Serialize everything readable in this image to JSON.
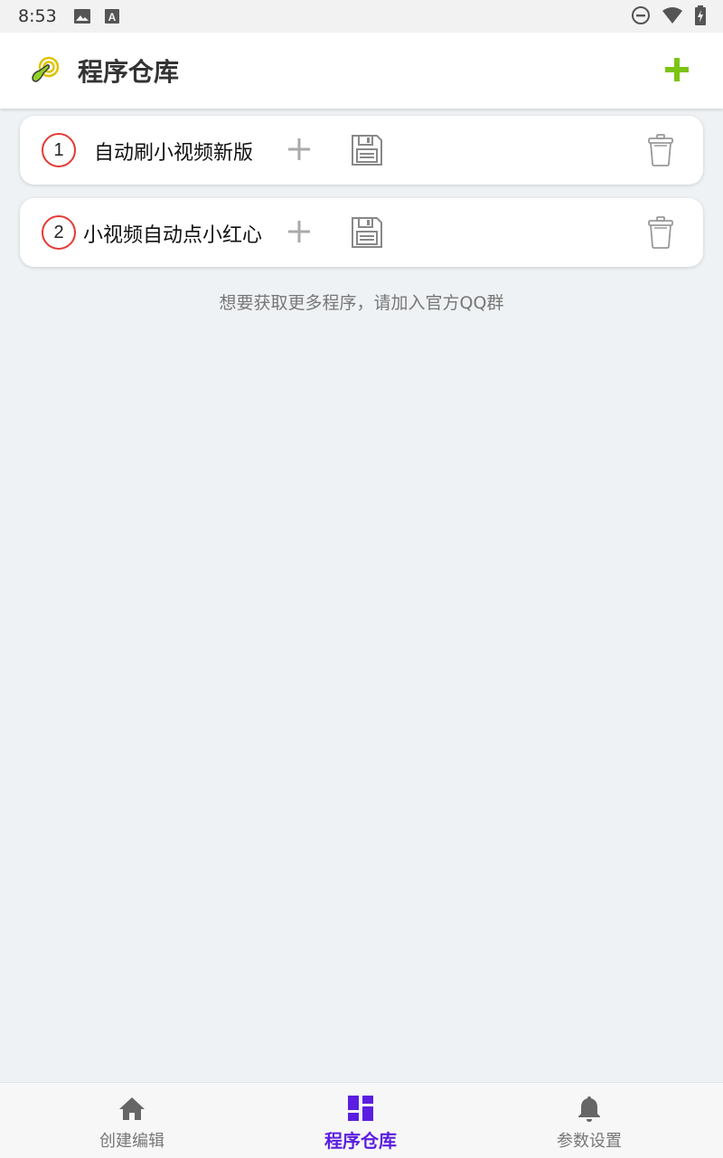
{
  "status_bar": {
    "time": "8:53",
    "icons": [
      "image-icon",
      "text-a-icon",
      "do-not-disturb-icon",
      "wifi-icon",
      "battery-charging-icon"
    ]
  },
  "app_bar": {
    "title": "程序仓库",
    "logo_icon": "tap-finger-icon",
    "add_icon": "plus-icon",
    "accent_color": "#7cc413"
  },
  "programs": [
    {
      "index": "1",
      "name": "自动刷小视频新版"
    },
    {
      "index": "2",
      "name": "小视频自动点小红心"
    }
  ],
  "hint": "想要获取更多程序，请加入官方QQ群",
  "bottom_nav": {
    "active_color": "#5b1ee0",
    "items": [
      {
        "label": "创建编辑",
        "icon": "home-icon",
        "active": false
      },
      {
        "label": "程序仓库",
        "icon": "dashboard-icon",
        "active": true
      },
      {
        "label": "参数设置",
        "icon": "bell-icon",
        "active": false
      }
    ]
  }
}
